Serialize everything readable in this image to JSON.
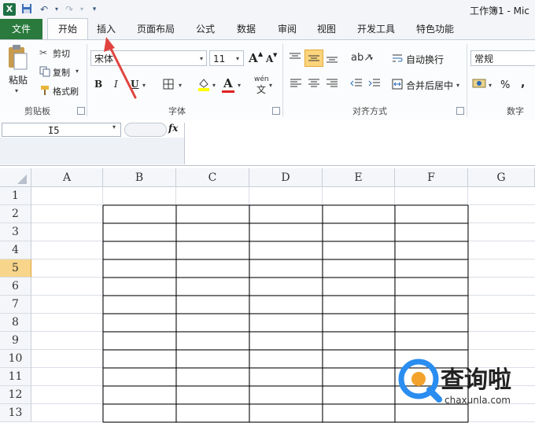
{
  "window": {
    "title": "工作簿1 - Mic"
  },
  "quick_access": {
    "save_icon": "save-icon",
    "undo_icon": "undo-icon",
    "redo_icon": "redo-icon",
    "customize_icon": "customize-icon"
  },
  "tabs": {
    "file": "文件",
    "items": [
      "开始",
      "插入",
      "页面布局",
      "公式",
      "数据",
      "审阅",
      "视图",
      "开发工具",
      "特色功能"
    ]
  },
  "ribbon": {
    "clipboard": {
      "paste": "粘贴",
      "cut": "剪切",
      "copy": "复制",
      "format_painter": "格式刷",
      "group": "剪贴板"
    },
    "font": {
      "name": "宋体",
      "size": "11",
      "bold": "B",
      "italic": "I",
      "underline": "U",
      "grow": "A",
      "shrink": "A",
      "font_color": "A",
      "wen": "wén",
      "group": "字体"
    },
    "alignment": {
      "wrap_text": "自动换行",
      "merge_center": "合并后居中",
      "group": "对齐方式"
    },
    "number": {
      "format": "常规",
      "percent": "%",
      "comma": ",",
      "group": "数字"
    }
  },
  "formula_bar": {
    "cell_ref": "I5",
    "fx": "fx",
    "content": ""
  },
  "grid": {
    "columns": [
      "A",
      "B",
      "C",
      "D",
      "E",
      "F",
      "G"
    ],
    "rows": [
      "1",
      "2",
      "3",
      "4",
      "5",
      "6",
      "7",
      "8",
      "9",
      "10",
      "11",
      "12",
      "13"
    ],
    "selected_row": "5"
  },
  "watermark": {
    "brand": "查询啦",
    "url": "chaxunla.com"
  },
  "colors": {
    "accent_file_tab": "#2a7a3d",
    "selected_row": "#f7d58a",
    "annotation": "#e0433f"
  }
}
